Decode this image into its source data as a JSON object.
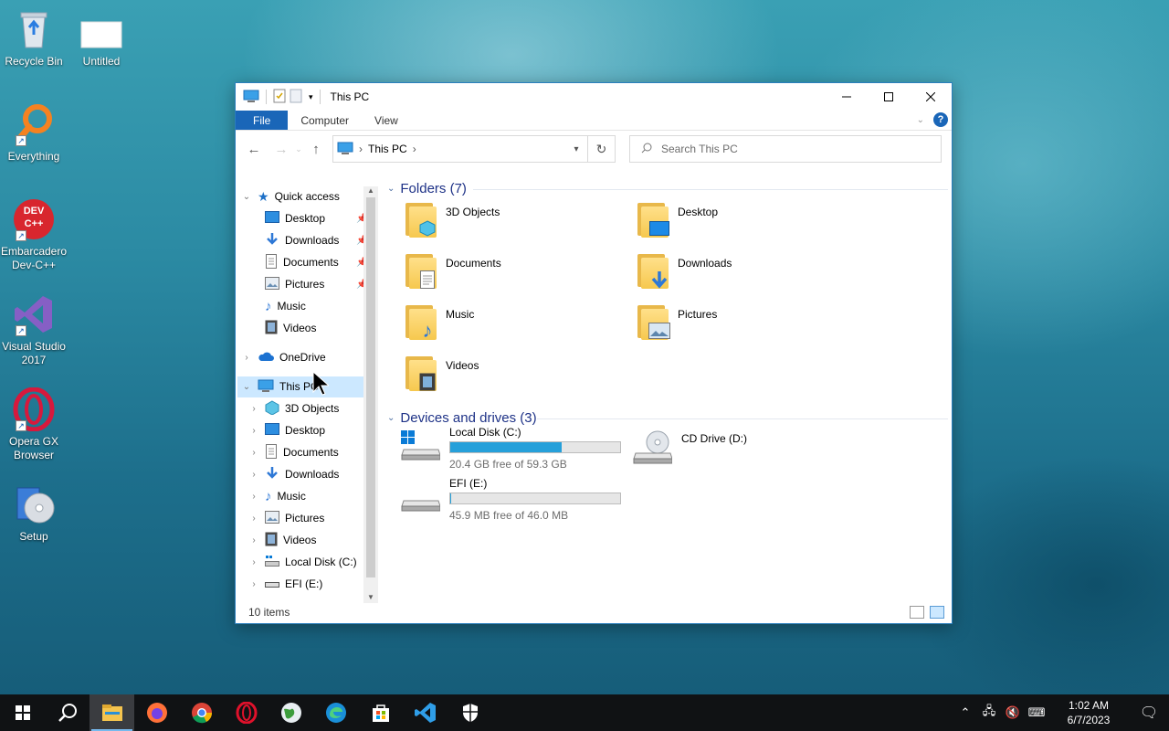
{
  "desktop": {
    "icons": [
      {
        "label": "Recycle Bin",
        "icon": "recycle-bin-icon"
      },
      {
        "label": "Untitled",
        "icon": "blank-file-icon"
      },
      {
        "label": "Everything",
        "icon": "everything-search-icon"
      },
      {
        "label": "Embarcadero Dev-C++",
        "icon": "devcpp-icon",
        "badge_text": "DEV C++"
      },
      {
        "label": "Visual Studio 2017",
        "icon": "visual-studio-icon"
      },
      {
        "label": "Opera GX Browser",
        "icon": "opera-gx-icon"
      },
      {
        "label": "Setup",
        "icon": "setup-cd-icon"
      }
    ]
  },
  "window": {
    "title": "This PC",
    "ribbon": {
      "file": "File",
      "tabs": [
        "Computer",
        "View"
      ],
      "help": "?"
    },
    "address": {
      "crumbs": [
        "This PC"
      ],
      "separator": "›"
    },
    "search": {
      "placeholder": "Search This PC"
    },
    "nav_pane": {
      "quick_access": "Quick access",
      "quick_items": [
        {
          "label": "Desktop",
          "icon": "desktop-icon",
          "pinned": true
        },
        {
          "label": "Downloads",
          "icon": "download-arrow-icon",
          "pinned": true
        },
        {
          "label": "Documents",
          "icon": "documents-icon",
          "pinned": true
        },
        {
          "label": "Pictures",
          "icon": "pictures-icon",
          "pinned": true
        },
        {
          "label": "Music",
          "icon": "music-note-icon",
          "pinned": false
        },
        {
          "label": "Videos",
          "icon": "videos-icon",
          "pinned": false
        }
      ],
      "onedrive": "OneDrive",
      "this_pc": "This PC",
      "this_pc_items": [
        {
          "label": "3D Objects",
          "icon": "3d-objects-icon"
        },
        {
          "label": "Desktop",
          "icon": "desktop-icon"
        },
        {
          "label": "Documents",
          "icon": "documents-icon"
        },
        {
          "label": "Downloads",
          "icon": "download-arrow-icon"
        },
        {
          "label": "Music",
          "icon": "music-note-icon"
        },
        {
          "label": "Pictures",
          "icon": "pictures-icon"
        },
        {
          "label": "Videos",
          "icon": "videos-icon"
        },
        {
          "label": "Local Disk (C:)",
          "icon": "local-disk-icon"
        },
        {
          "label": "EFI (E:)",
          "icon": "drive-icon"
        }
      ]
    },
    "folders_group": "Folders (7)",
    "folders": [
      {
        "label": "3D Objects",
        "icon": "3d-objects-icon"
      },
      {
        "label": "Desktop",
        "icon": "desktop-icon"
      },
      {
        "label": "Documents",
        "icon": "documents-icon"
      },
      {
        "label": "Downloads",
        "icon": "download-arrow-icon"
      },
      {
        "label": "Music",
        "icon": "music-note-icon"
      },
      {
        "label": "Pictures",
        "icon": "pictures-icon"
      },
      {
        "label": "Videos",
        "icon": "videos-icon"
      }
    ],
    "drives_group": "Devices and drives (3)",
    "drives": [
      {
        "label": "Local Disk (C:)",
        "free": "20.4 GB free of 59.3 GB",
        "used_fraction": 0.656,
        "icon": "local-disk-icon"
      },
      {
        "label": "CD Drive (D:)",
        "free": "",
        "used_fraction": null,
        "icon": "cd-drive-icon"
      },
      {
        "label": "EFI (E:)",
        "free": "45.9 MB free of 46.0 MB",
        "used_fraction": 0.002,
        "icon": "drive-icon"
      }
    ],
    "status": "10 items",
    "colors": {
      "accent": "#1a66b8",
      "selection": "#cce8ff",
      "drive_bar": "#26a0da",
      "group_header": "#1e3287"
    }
  },
  "taskbar": {
    "apps": [
      {
        "name": "start-button",
        "icon": "windows-logo-icon"
      },
      {
        "name": "search-button",
        "icon": "search-icon"
      },
      {
        "name": "file-explorer",
        "icon": "file-explorer-icon",
        "active": true
      },
      {
        "name": "firefox",
        "icon": "firefox-icon"
      },
      {
        "name": "chrome",
        "icon": "chrome-icon"
      },
      {
        "name": "opera",
        "icon": "opera-icon"
      },
      {
        "name": "earth",
        "icon": "globe-icon"
      },
      {
        "name": "edge",
        "icon": "edge-icon"
      },
      {
        "name": "store",
        "icon": "store-icon"
      },
      {
        "name": "vscode",
        "icon": "vscode-icon"
      },
      {
        "name": "security",
        "icon": "shield-icon"
      }
    ],
    "clock": {
      "time": "1:02 AM",
      "date": "6/7/2023"
    }
  }
}
